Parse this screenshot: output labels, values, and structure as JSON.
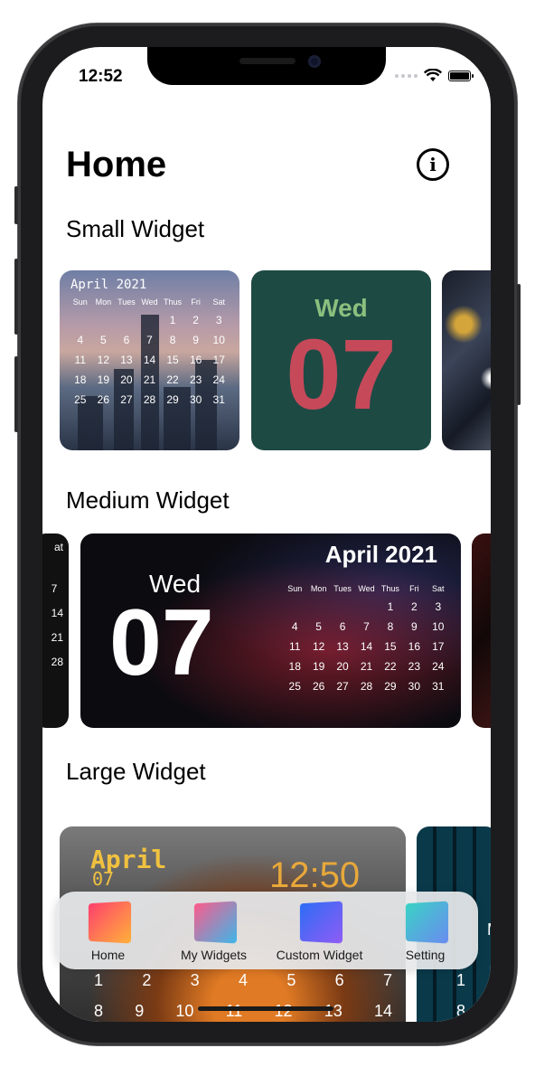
{
  "status": {
    "time": "12:52"
  },
  "header": {
    "title": "Home"
  },
  "sections": {
    "small": "Small Widget",
    "medium": "Medium Widget",
    "large": "Large Widget"
  },
  "small_calendar": {
    "month": "April 2021",
    "weekdays": [
      "Sun",
      "Mon",
      "Tues",
      "Wed",
      "Thus",
      "Fri",
      "Sat"
    ],
    "days": [
      "",
      "",
      "",
      "",
      "1",
      "2",
      "3",
      "4",
      "5",
      "6",
      "7",
      "8",
      "9",
      "10",
      "11",
      "12",
      "13",
      "14",
      "15",
      "16",
      "17",
      "18",
      "19",
      "20",
      "21",
      "22",
      "23",
      "24",
      "25",
      "26",
      "27",
      "28",
      "29",
      "30",
      "31"
    ]
  },
  "small_date": {
    "day": "Wed",
    "number": "07"
  },
  "medium_left": {
    "header": "at",
    "days": [
      "7",
      "14",
      "21",
      "28"
    ]
  },
  "medium_widget": {
    "day": "Wed",
    "number": "07",
    "month": "April 2021",
    "weekdays": [
      "Sun",
      "Mon",
      "Tues",
      "Wed",
      "Thus",
      "Fri",
      "Sat"
    ],
    "days": [
      "",
      "",
      "",
      "",
      "1",
      "2",
      "3",
      "4",
      "5",
      "6",
      "7",
      "8",
      "9",
      "10",
      "11",
      "12",
      "13",
      "14",
      "15",
      "16",
      "17",
      "18",
      "19",
      "20",
      "21",
      "22",
      "23",
      "24",
      "25",
      "26",
      "27",
      "28",
      "29",
      "30",
      "31"
    ]
  },
  "large_widget": {
    "month": "April",
    "number": "07",
    "time": "12:50",
    "row1": [
      "1",
      "2",
      "3",
      "4",
      "5",
      "6",
      "7"
    ],
    "row2": [
      "8",
      "9",
      "10",
      "11",
      "12",
      "13",
      "14"
    ]
  },
  "large_widget_2": {
    "letter": "M",
    "n1": "1",
    "n2": "8"
  },
  "tabs": [
    {
      "label": "Home",
      "color_a": "#ff3d6e",
      "color_b": "#ffb03a"
    },
    {
      "label": "My Widgets",
      "color_a": "#ff5a8a",
      "color_b": "#3fb6e8"
    },
    {
      "label": "Custom Widget",
      "color_a": "#2a6df5",
      "color_b": "#8f5cf5"
    },
    {
      "label": "Setting",
      "color_a": "#39d4c4",
      "color_b": "#6a8cf0"
    }
  ]
}
